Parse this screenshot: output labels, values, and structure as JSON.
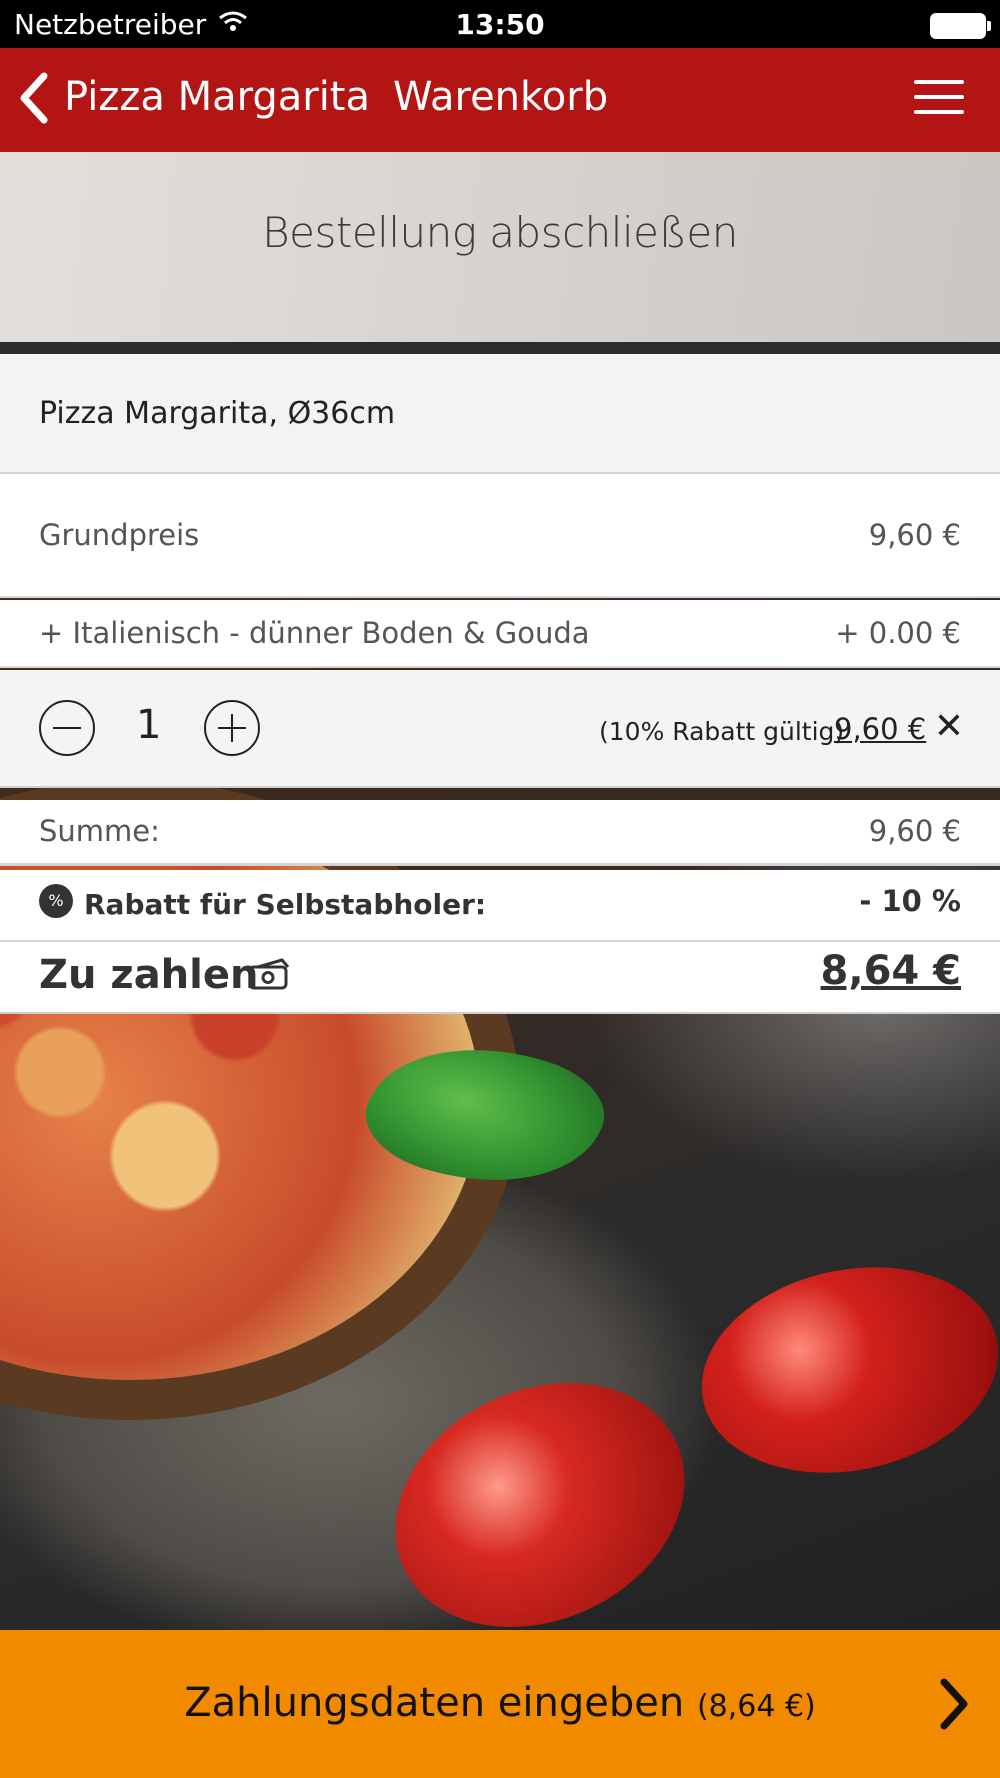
{
  "status_bar": {
    "carrier": "Netzbetreiber",
    "time": "13:50"
  },
  "nav": {
    "back_label": "Pizza Margarita",
    "title": "Warenkorb"
  },
  "banner": {
    "title": "Bestellung abschließen"
  },
  "item": {
    "name": "Pizza Margarita, Ø36cm",
    "base_label": "Grundpreis",
    "base_price": "9,60 €",
    "extra_label": "+ Italienisch - dünner Boden & Gouda",
    "extra_price": "+ 0.00 €",
    "quantity": "1",
    "discount_note": "(10% Rabatt gültig)",
    "line_price": "9,60 €"
  },
  "summary": {
    "sum_label": "Summe:",
    "sum_value": "9,60 €",
    "discount_icon_text": "%",
    "discount_label": "Rabatt für Selbstabholer:",
    "discount_value": "- 10 %",
    "total_label": "Zu zahlen",
    "total_value": "8,64 €"
  },
  "cta": {
    "label": "Zahlungsdaten eingeben",
    "amount": "(8,64 €)"
  },
  "colors": {
    "nav": "#b21513",
    "cta": "#f28a00"
  }
}
